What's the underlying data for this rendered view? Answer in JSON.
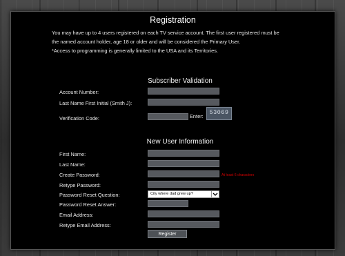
{
  "title": "Registration",
  "intro": {
    "line1": "You may have up to 4 users registered on each TV service account. The first user registered must be",
    "line2": "the named account holder, age 18 or older and will be considered the Primary User.",
    "line3": "*Access to programming is generally limited to the USA and its Territories."
  },
  "subscriber_validation": {
    "heading": "Subscriber Validation",
    "account_number_label": "Account Number:",
    "last_name_label": "Last Name First Initial (Smith J):",
    "verification_code_label": "Verification Code:",
    "enter_label": "Enter:",
    "captcha_text": "53069"
  },
  "new_user": {
    "heading": "New User Information",
    "first_name_label": "First Name:",
    "last_name_label": "Last Name:",
    "create_password_label": "Create Password:",
    "password_hint": "At least 6 characters",
    "retype_password_label": "Retype Password:",
    "reset_question_label": "Password Reset Question:",
    "reset_question_value": "City where dad grew up?",
    "reset_answer_label": "Password Reset Answer:",
    "email_label": "Email Address:",
    "retype_email_label": "Retype Email Address:",
    "register_button": "Register"
  },
  "colors": {
    "panel_background": "#000000",
    "field_background": "#56595e",
    "hint_red": "#d40000",
    "text": "#e8e8e8"
  }
}
